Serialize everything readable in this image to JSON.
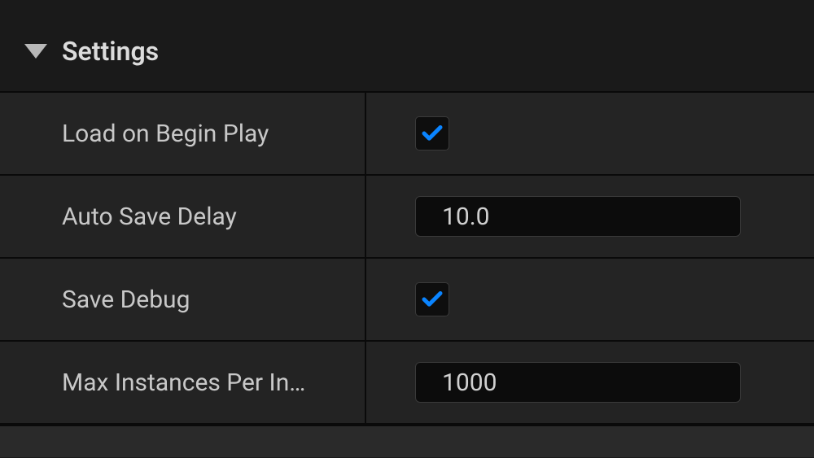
{
  "section": {
    "title": "Settings"
  },
  "settings": {
    "load_on_begin_play": {
      "label": "Load on Begin Play",
      "checked": true
    },
    "auto_save_delay": {
      "label": "Auto Save Delay",
      "value": "10.0"
    },
    "save_debug": {
      "label": "Save Debug",
      "checked": true
    },
    "max_instances": {
      "label": "Max Instances Per In…",
      "value": "1000"
    }
  }
}
